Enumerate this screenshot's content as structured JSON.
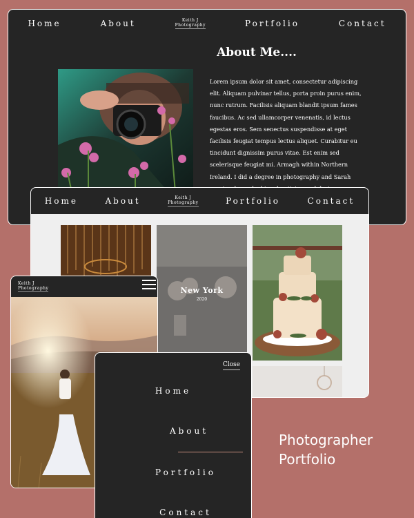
{
  "brand": {
    "line1": "Keith J",
    "line2": "Photography"
  },
  "nav": [
    "Home",
    "About",
    "Portfolio",
    "Contact"
  ],
  "about": {
    "title": "About Me....",
    "body": "Lorem ipsum dolor sit amet, consectetur adipiscing elit. Aliquam pulvinar tellus, porta proin purus enim, nunc rutrum. Facilisis aliquam blandit ipsum fames faucibus. Ac sed ullamcorper venenatis, id lectus egestas eros. Sem senectus suspendisse at eget facilisis feugiat tempus lectus aliquet. Curabitur eu tincidunt dignissim purus vitae. Est enim sed scelerisque feugiat mi. Armagh within Northern Ireland. I did a degree in photography and Sarah previously worked in advertising and design photography."
  },
  "portfolio": {
    "caption_title": "New York",
    "caption_year": "2020"
  },
  "mobile_menu": {
    "close": "Close",
    "items": [
      "Home",
      "About",
      "Portfolio",
      "Contact"
    ]
  },
  "headline": {
    "line1": "Photographer",
    "line2": "Portfolio"
  },
  "colors": {
    "background": "#b4706a",
    "dark": "#252525",
    "divider": "#c98e7f"
  }
}
